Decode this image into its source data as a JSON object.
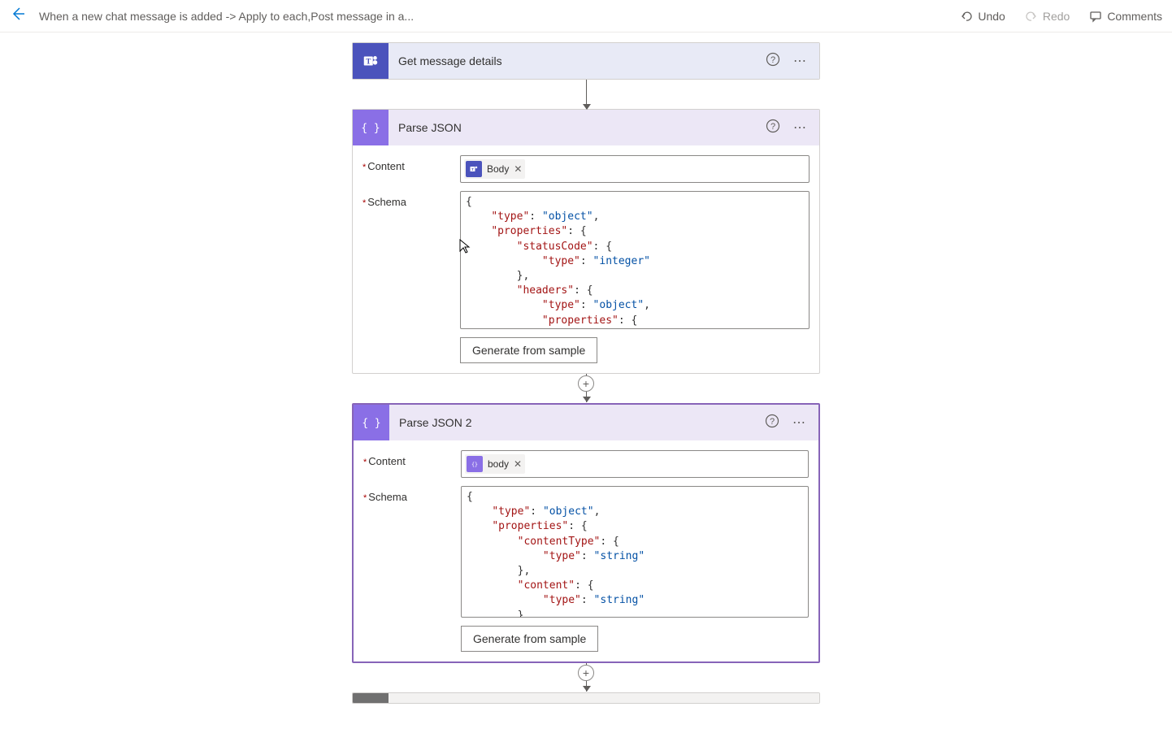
{
  "topbar": {
    "breadcrumb": "When a new chat message is added -> Apply to each,Post message in a...",
    "undo": "Undo",
    "redo": "Redo",
    "comments": "Comments"
  },
  "card1": {
    "title": "Get message details"
  },
  "card2": {
    "title": "Parse JSON",
    "content_label": "Content",
    "token": "Body",
    "schema_label": "Schema",
    "generate": "Generate from sample"
  },
  "card3": {
    "title": "Parse JSON 2",
    "content_label": "Content",
    "token": "body",
    "schema_label": "Schema",
    "generate": "Generate from sample"
  }
}
